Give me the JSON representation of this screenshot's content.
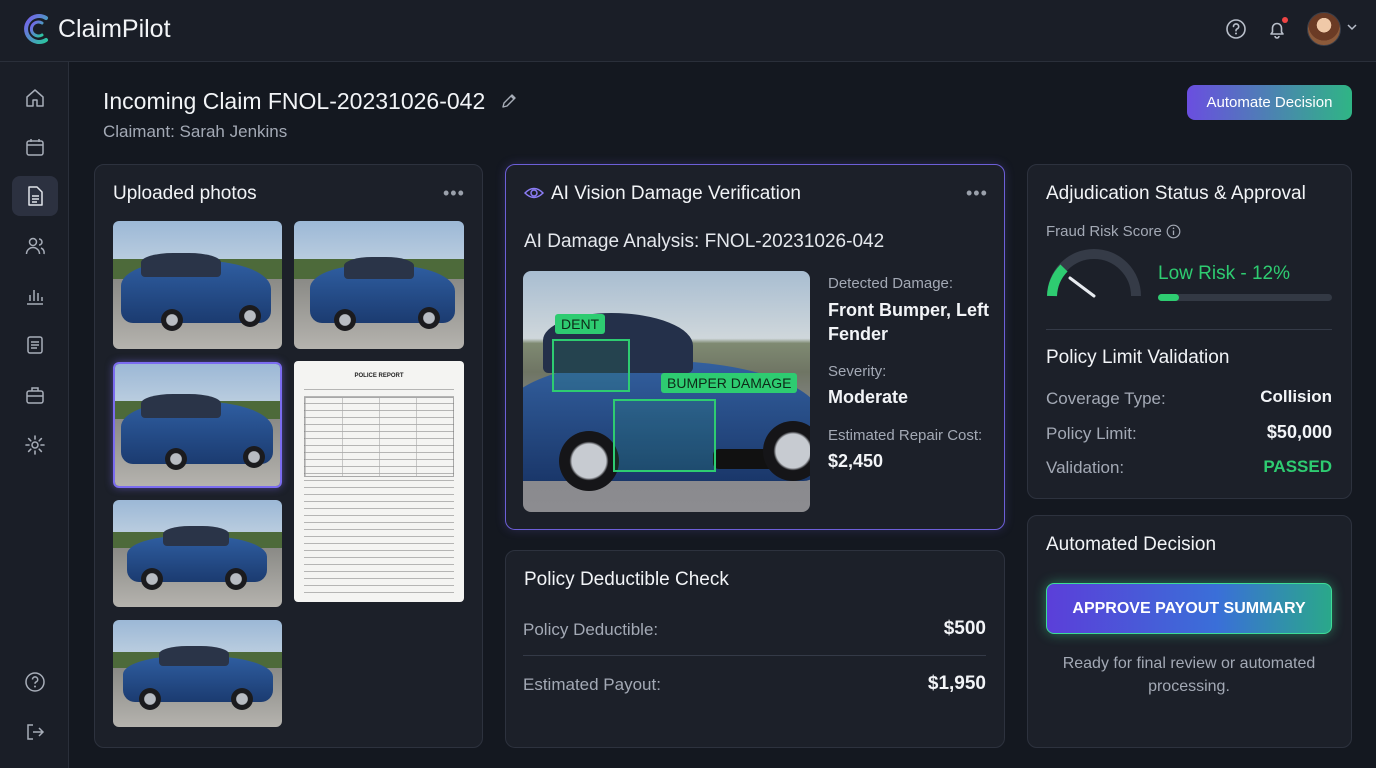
{
  "app": {
    "name": "ClaimPilot"
  },
  "header": {
    "title": "Incoming Claim FNOL-20231026-042",
    "claimant": "Claimant: Sarah Jenkins",
    "automate_button": "Automate Decision"
  },
  "sidebar": {
    "items": [
      {
        "icon": "home-icon",
        "active": false
      },
      {
        "icon": "calendar-icon",
        "active": false
      },
      {
        "icon": "document-icon",
        "active": true
      },
      {
        "icon": "users-icon",
        "active": false
      },
      {
        "icon": "bar-chart-icon",
        "active": false
      },
      {
        "icon": "list-icon",
        "active": false
      },
      {
        "icon": "briefcase-icon",
        "active": false
      },
      {
        "icon": "gear-icon",
        "active": false
      }
    ],
    "bottom_items": [
      {
        "icon": "help-icon"
      },
      {
        "icon": "logout-icon"
      }
    ]
  },
  "photos": {
    "title": "Uploaded photos",
    "menu": "•••",
    "document_title": "POLICE REPORT"
  },
  "vision": {
    "title": "AI Vision Damage Verification",
    "menu": "•••",
    "subtitle": "AI Damage Analysis: FNOL-20231026-042",
    "labels": {
      "dent": "DENT",
      "bumper": "BUMPER DAMAGE"
    },
    "detected_label": "Detected Damage:",
    "detected_value": "Front Bumper, Left Fender",
    "severity_label": "Severity:",
    "severity_value": "Moderate",
    "cost_label": "Estimated Repair Cost:",
    "cost_value": "$2,450"
  },
  "deductible": {
    "title": "Policy Deductible Check",
    "deductible_label": "Policy Deductible:",
    "deductible_value": "$500",
    "payout_label": "Estimated Payout:",
    "payout_value": "$1,950"
  },
  "adjudication": {
    "title": "Adjudication Status & Approval",
    "fraud_label": "Fraud Risk Score",
    "fraud_value": "Low Risk - 12%",
    "fraud_fraction": 0.12,
    "policy_title": "Policy Limit Validation",
    "coverage_label": "Coverage Type:",
    "coverage_value": "Collision",
    "limit_label": "Policy Limit:",
    "limit_value": "$50,000",
    "validation_label": "Validation:",
    "validation_value": "PASSED",
    "colors": {
      "good": "#2ecc71"
    }
  },
  "decision": {
    "title": "Automated Decision",
    "button": "APPROVE PAYOUT SUMMARY",
    "note": "Ready for final review or automated processing."
  }
}
